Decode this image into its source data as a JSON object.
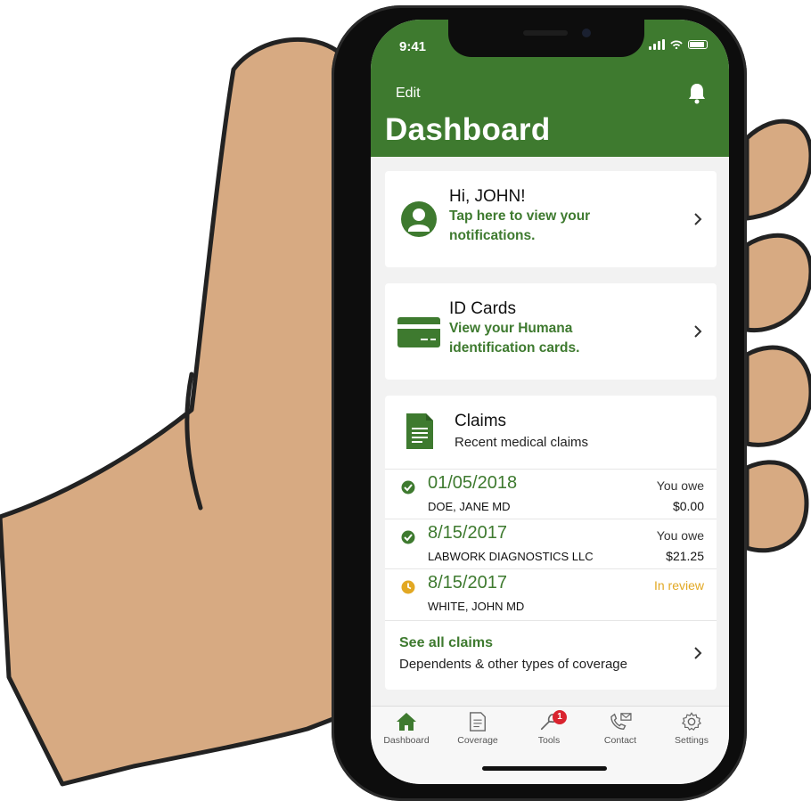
{
  "status_bar": {
    "time": "9:41"
  },
  "header": {
    "edit_label": "Edit",
    "title": "Dashboard"
  },
  "greeting_card": {
    "title": "Hi, JOHN!",
    "link_line1": "Tap here to view your",
    "link_line2": "notifications."
  },
  "id_card": {
    "title": "ID Cards",
    "link_line1": "View your Humana",
    "link_line2": "identification cards."
  },
  "claims_card": {
    "title": "Claims",
    "subtitle": "Recent medical claims",
    "rows": [
      {
        "date": "01/05/2018",
        "provider": "DOE, JANE MD",
        "owe_label": "You owe",
        "amount": "$0.00",
        "status": "complete"
      },
      {
        "date": "8/15/2017",
        "provider": "LABWORK DIAGNOSTICS LLC",
        "owe_label": "You owe",
        "amount": "$21.25",
        "status": "complete"
      },
      {
        "date": "8/15/2017",
        "provider": "WHITE, JOHN MD",
        "status_label": "In review",
        "status": "pending"
      }
    ],
    "see_all_label": "See all claims",
    "see_all_sub": "Dependents & other types of coverage"
  },
  "tabbar": {
    "tabs": [
      {
        "label": "Dashboard",
        "icon": "home-icon"
      },
      {
        "label": "Coverage",
        "icon": "document-icon"
      },
      {
        "label": "Tools",
        "icon": "wrench-icon",
        "badge": "1"
      },
      {
        "label": "Contact",
        "icon": "phone-mail-icon"
      },
      {
        "label": "Settings",
        "icon": "gear-icon"
      }
    ]
  },
  "colors": {
    "brand_green": "#3e7a2f",
    "pending_yellow": "#e2a823",
    "badge_red": "#d9232e",
    "skin": "#d7aa82"
  }
}
